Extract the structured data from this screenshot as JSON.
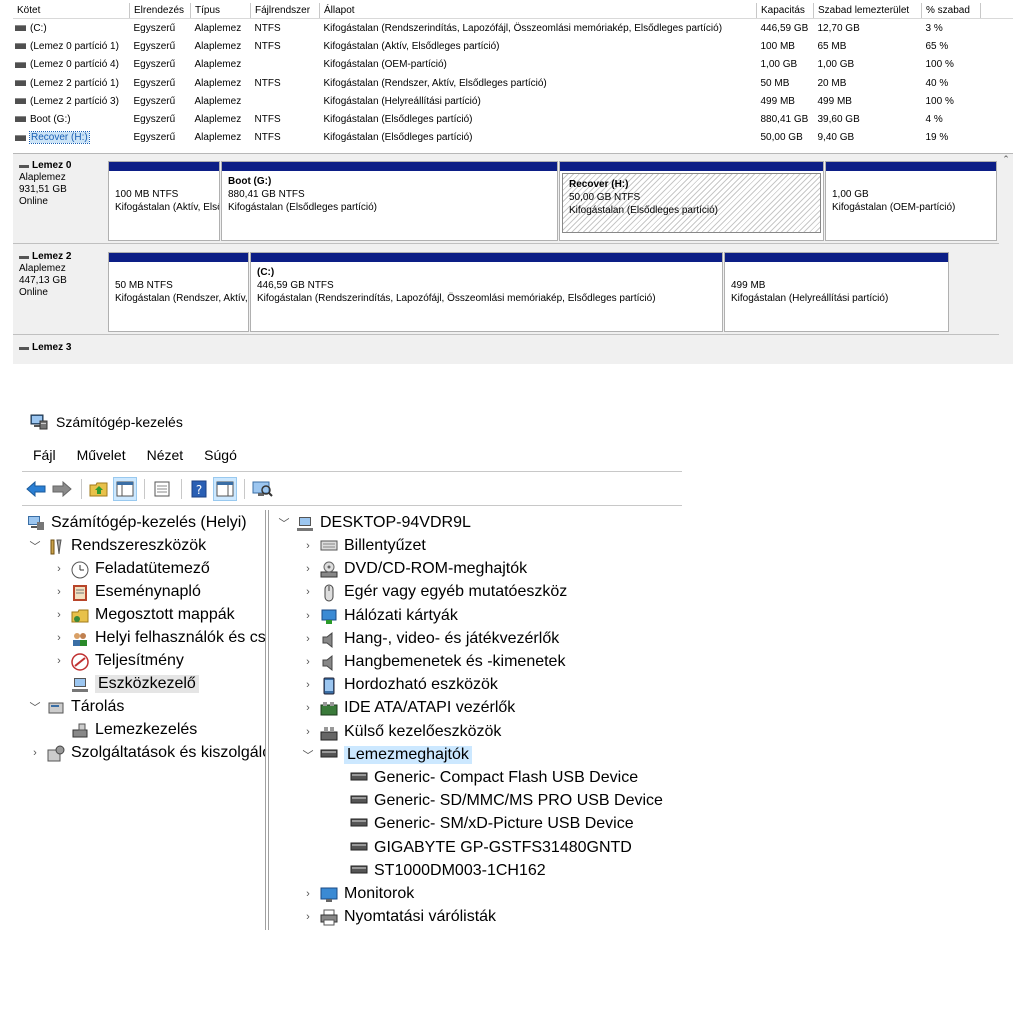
{
  "volumes": {
    "columns": [
      "Kötet",
      "Elrendezés",
      "Típus",
      "Fájlrendszer",
      "Állapot",
      "Kapacitás",
      "Szabad lemezterület",
      "% szabad"
    ],
    "rows": [
      [
        "(C:)",
        "Egyszerű",
        "Alaplemez",
        "NTFS",
        "Kifogástalan (Rendszerindítás, Lapozófájl, Összeomlási memóriakép, Elsődleges partíció)",
        "446,59 GB",
        "12,70 GB",
        "3 %"
      ],
      [
        "(Lemez 0 partíció 1)",
        "Egyszerű",
        "Alaplemez",
        "NTFS",
        "Kifogástalan (Aktív, Elsődleges partíció)",
        "100 MB",
        "65 MB",
        "65 %"
      ],
      [
        "(Lemez 0 partíció 4)",
        "Egyszerű",
        "Alaplemez",
        "",
        "Kifogástalan (OEM-partíció)",
        "1,00 GB",
        "1,00 GB",
        "100 %"
      ],
      [
        "(Lemez 2 partíció 1)",
        "Egyszerű",
        "Alaplemez",
        "NTFS",
        "Kifogástalan (Rendszer, Aktív, Elsődleges partíció)",
        "50 MB",
        "20 MB",
        "40 %"
      ],
      [
        "(Lemez 2 partíció 3)",
        "Egyszerű",
        "Alaplemez",
        "",
        "Kifogástalan (Helyreállítási partíció)",
        "499 MB",
        "499 MB",
        "100 %"
      ],
      [
        "Boot (G:)",
        "Egyszerű",
        "Alaplemez",
        "NTFS",
        "Kifogástalan (Elsődleges partíció)",
        "880,41 GB",
        "39,60 GB",
        "4 %"
      ],
      [
        "Recover (H:)",
        "Egyszerű",
        "Alaplemez",
        "NTFS",
        "Kifogástalan (Elsődleges partíció)",
        "50,00 GB",
        "9,40 GB",
        "19 %"
      ]
    ]
  },
  "disks": [
    {
      "name": "Lemez 0",
      "type": "Alaplemez",
      "size": "931,51 GB",
      "status": "Online",
      "partitions": [
        {
          "title": "",
          "line1": "100 MB NTFS",
          "line2": "Kifogástalan (Aktív, Elsődleges partíció)"
        },
        {
          "title": "Boot  (G:)",
          "line1": "880,41 GB NTFS",
          "line2": "Kifogástalan (Elsődleges partíció)"
        },
        {
          "title": "Recover  (H:)",
          "line1": "50,00 GB NTFS",
          "line2": "Kifogástalan (Elsődleges partíció)"
        },
        {
          "title": "",
          "line1": "1,00 GB",
          "line2": "Kifogástalan (OEM-partíció)"
        }
      ]
    },
    {
      "name": "Lemez 2",
      "type": "Alaplemez",
      "size": "447,13 GB",
      "status": "Online",
      "partitions": [
        {
          "title": "",
          "line1": "50 MB NTFS",
          "line2": "Kifogástalan (Rendszer, Aktív, Elsődleges partíció)"
        },
        {
          "title": "(C:)",
          "line1": "446,59 GB NTFS",
          "line2": "Kifogástalan (Rendszerindítás, Lapozófájl, Összeomlási memóriakép, Elsődleges partíció)"
        },
        {
          "title": "",
          "line1": "499 MB",
          "line2": "Kifogástalan (Helyreállítási partíció)"
        }
      ]
    },
    {
      "name": "Lemez 3"
    }
  ],
  "window": {
    "title": "Számítógép-kezelés"
  },
  "menu": [
    "Fájl",
    "Művelet",
    "Nézet",
    "Súgó"
  ],
  "left_tree": [
    {
      "label": "Számítógép-kezelés (Helyi)",
      "icon": "computer-management-icon"
    },
    {
      "label": "Rendszereszközök",
      "icon": "tools-icon"
    },
    {
      "label": "Feladatütemező",
      "icon": "clock-icon"
    },
    {
      "label": "Eseménynapló",
      "icon": "event-viewer-icon"
    },
    {
      "label": "Megosztott mappák",
      "icon": "shared-folder-icon"
    },
    {
      "label": "Helyi felhasználók és csoportok",
      "icon": "users-icon"
    },
    {
      "label": "Teljesítmény",
      "icon": "performance-icon"
    },
    {
      "label": "Eszközkezelő",
      "icon": "device-manager-icon"
    },
    {
      "label": "Tárolás",
      "icon": "storage-icon"
    },
    {
      "label": "Lemezkezelés",
      "icon": "disk-management-icon"
    },
    {
      "label": "Szolgáltatások és kiszolgálóalkalmazások",
      "icon": "services-icon"
    }
  ],
  "right_tree": {
    "root": "DESKTOP-94VDR9L",
    "categories": [
      {
        "label": "Billentyűzet",
        "icon": "keyboard-icon"
      },
      {
        "label": "DVD/CD-ROM-meghajtók",
        "icon": "dvd-drive-icon"
      },
      {
        "label": "Egér vagy egyéb mutatóeszköz",
        "icon": "mouse-icon"
      },
      {
        "label": "Hálózati kártyák",
        "icon": "network-adapter-icon"
      },
      {
        "label": "Hang-, video- és játékvezérlők",
        "icon": "speaker-icon"
      },
      {
        "label": "Hangbemenetek és -kimenetek",
        "icon": "audio-io-icon"
      },
      {
        "label": "Hordozható eszközök",
        "icon": "portable-device-icon"
      },
      {
        "label": "IDE ATA/ATAPI vezérlők",
        "icon": "ide-controller-icon"
      },
      {
        "label": "Külső kezelőeszközök",
        "icon": "hid-icon"
      },
      {
        "label": "Lemezmeghajtók",
        "icon": "disk-drive-icon"
      },
      {
        "label": "Monitorok",
        "icon": "monitor-icon"
      },
      {
        "label": "Nyomtatási várólisták",
        "icon": "printer-icon"
      }
    ],
    "disk_drives": [
      "Generic- Compact Flash USB Device",
      "Generic- SD/MMC/MS PRO USB Device",
      "Generic- SM/xD-Picture USB Device",
      "GIGABYTE GP-GSTFS31480GNTD",
      "ST1000DM003-1CH162"
    ]
  },
  "colors": {
    "partition_header": "#0c1e86",
    "selection": "#cce8ff"
  }
}
